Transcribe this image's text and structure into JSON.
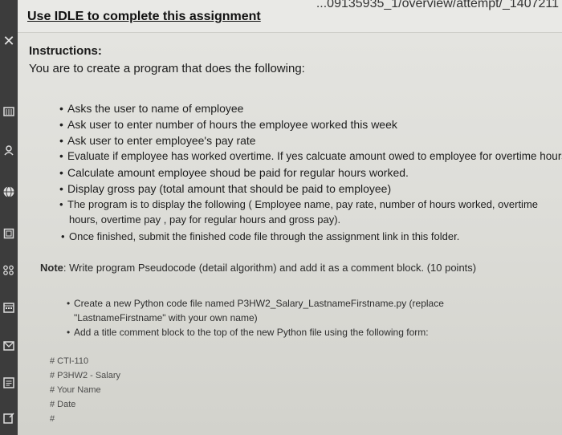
{
  "browser": {
    "url_fragment": "...09135935_1/overview/attempt/_1407211"
  },
  "assignment": {
    "title": "Use IDLE to complete this assignment",
    "instructions_heading": "Instructions:",
    "intro": "You are to create a program that does the following:",
    "bullets": [
      "Asks the user to name of employee",
      "Ask user to enter number of hours the employee worked this week",
      "Ask user to enter employee's pay rate",
      "Evaluate if employee has worked overtime. If yes calcuate amount owed to employee for overtime hours",
      "Calculate amount employee shoud be paid for regular hours worked.",
      "Display gross pay (total amount that should be paid to employee)",
      "The program is to display the following ( Employee name, pay rate, number of hours worked, overtime",
      "hours, overtime pay , pay for regular hours and gross pay).",
      "Once finished, submit the finished code file through the assignment link in this folder."
    ],
    "note_label": "Note",
    "note_text": ": Write program Pseudocode (detail algorithm) and add it as a comment block. (10 points)",
    "sub_bullets": [
      "Create a new Python code file named P3HW2_Salary_LastnameFirstname.py (replace",
      "\"LastnameFirstname\" with your own name)",
      "Add a title comment block to the top of the new Python file using the following form:"
    ],
    "comment_block": [
      "# CTI-110",
      "# P3HW2 - Salary",
      "# Your Name",
      "# Date",
      "#"
    ]
  },
  "sidebar": {
    "icons": [
      "close-icon",
      "institution-icon",
      "account-icon",
      "globe-icon",
      "courses-icon",
      "groups-icon",
      "calendar-icon",
      "inbox-icon",
      "history-icon",
      "help-icon"
    ]
  }
}
